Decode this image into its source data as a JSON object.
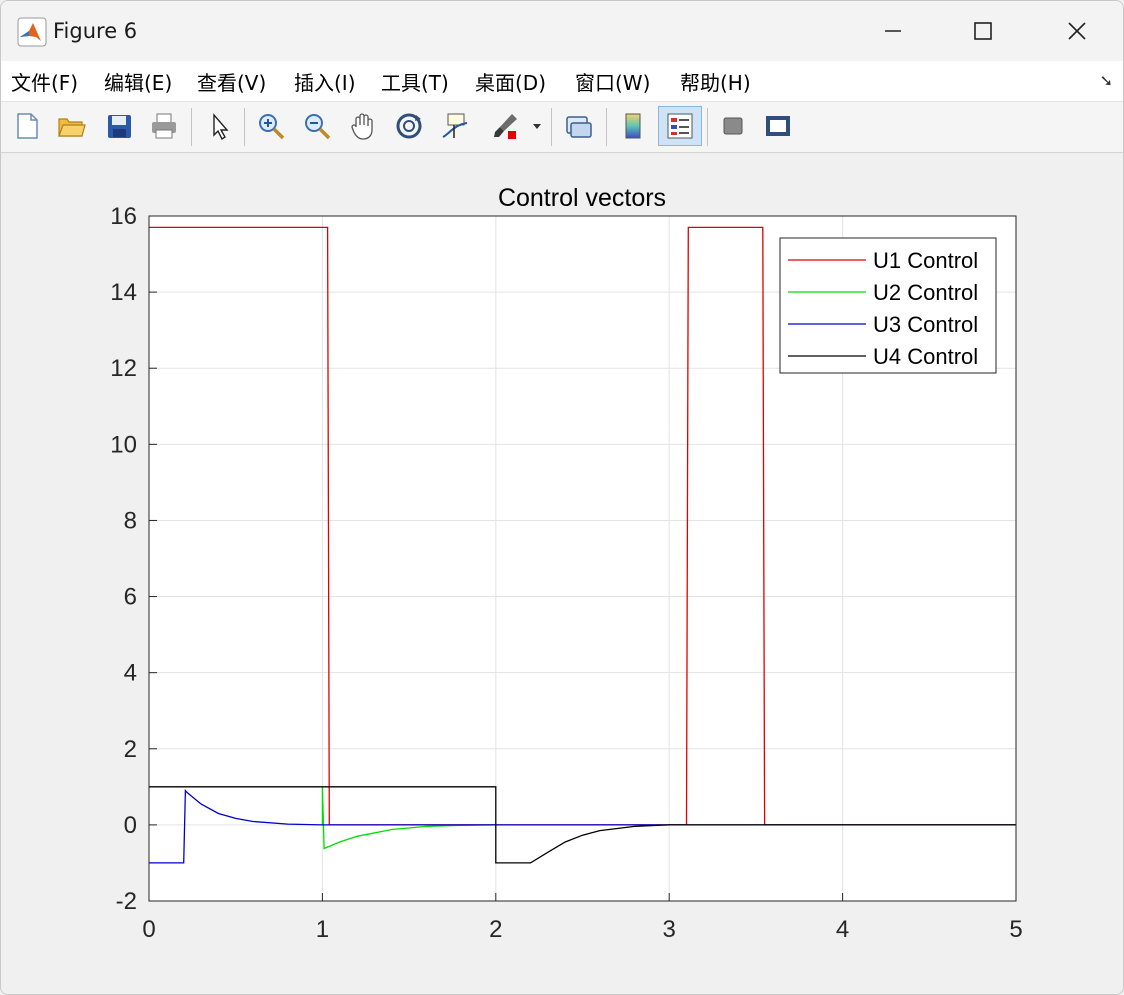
{
  "window": {
    "title": "Figure 6"
  },
  "window_controls": {
    "minimize": "—",
    "maximize": "☐",
    "close": "✕"
  },
  "menu": [
    "文件(F)",
    "编辑(E)",
    "查看(V)",
    "插入(I)",
    "工具(T)",
    "桌面(D)",
    "窗口(W)",
    "帮助(H)"
  ],
  "toolbar": [
    "new-figure-icon",
    "open-file-icon",
    "save-icon",
    "print-icon",
    "edit-plot-arrow-icon",
    "zoom-in-icon",
    "zoom-out-icon",
    "pan-hand-icon",
    "rotate-3d-icon",
    "data-cursor-icon",
    "brush-icon",
    "link-plot-icon",
    "colorbar-icon",
    "legend-icon",
    "hide-plot-tools-icon",
    "show-plot-tools-icon"
  ],
  "colors": {
    "u1": "#e00000",
    "u2": "#00dd00",
    "u3": "#0000cc",
    "u4": "#000000"
  },
  "chart_data": {
    "type": "line",
    "title": "Control vectors",
    "xlabel": "",
    "ylabel": "",
    "xlim": [
      0,
      5
    ],
    "ylim": [
      -2,
      16
    ],
    "xticks": [
      "0",
      "1",
      "2",
      "3",
      "4",
      "5"
    ],
    "yticks": [
      "-2",
      "0",
      "2",
      "4",
      "6",
      "8",
      "10",
      "12",
      "14",
      "16"
    ],
    "grid": true,
    "legend_position": "top-right",
    "series": [
      {
        "name": "U1 Control",
        "color": "#e00000",
        "x": [
          0,
          1.03,
          1.04,
          3.1,
          3.11,
          3.54,
          3.55,
          5
        ],
        "y": [
          15.7,
          15.7,
          0,
          0,
          15.7,
          15.7,
          0,
          0
        ]
      },
      {
        "name": "U2 Control",
        "color": "#00dd00",
        "x": [
          1.0,
          1.0,
          1.01,
          1.1,
          1.2,
          1.4,
          1.6,
          1.8,
          2.0
        ],
        "y": [
          0,
          1.0,
          -0.62,
          -0.45,
          -0.3,
          -0.12,
          -0.04,
          -0.01,
          0
        ]
      },
      {
        "name": "U3 Control",
        "color": "#0000cc",
        "x": [
          0,
          0.2,
          0.21,
          0.22,
          0.3,
          0.4,
          0.5,
          0.6,
          0.8,
          1.0,
          5
        ],
        "y": [
          -1,
          -1,
          0.9,
          0.85,
          0.55,
          0.3,
          0.17,
          0.09,
          0.02,
          0,
          0
        ]
      },
      {
        "name": "U4 Control",
        "color": "#000000",
        "x": [
          0,
          2.0,
          2.0,
          2.2,
          2.3,
          2.4,
          2.5,
          2.6,
          2.8,
          3.0,
          5
        ],
        "y": [
          1,
          1,
          -1,
          -1,
          -0.72,
          -0.45,
          -0.27,
          -0.15,
          -0.04,
          0,
          0
        ]
      }
    ]
  }
}
